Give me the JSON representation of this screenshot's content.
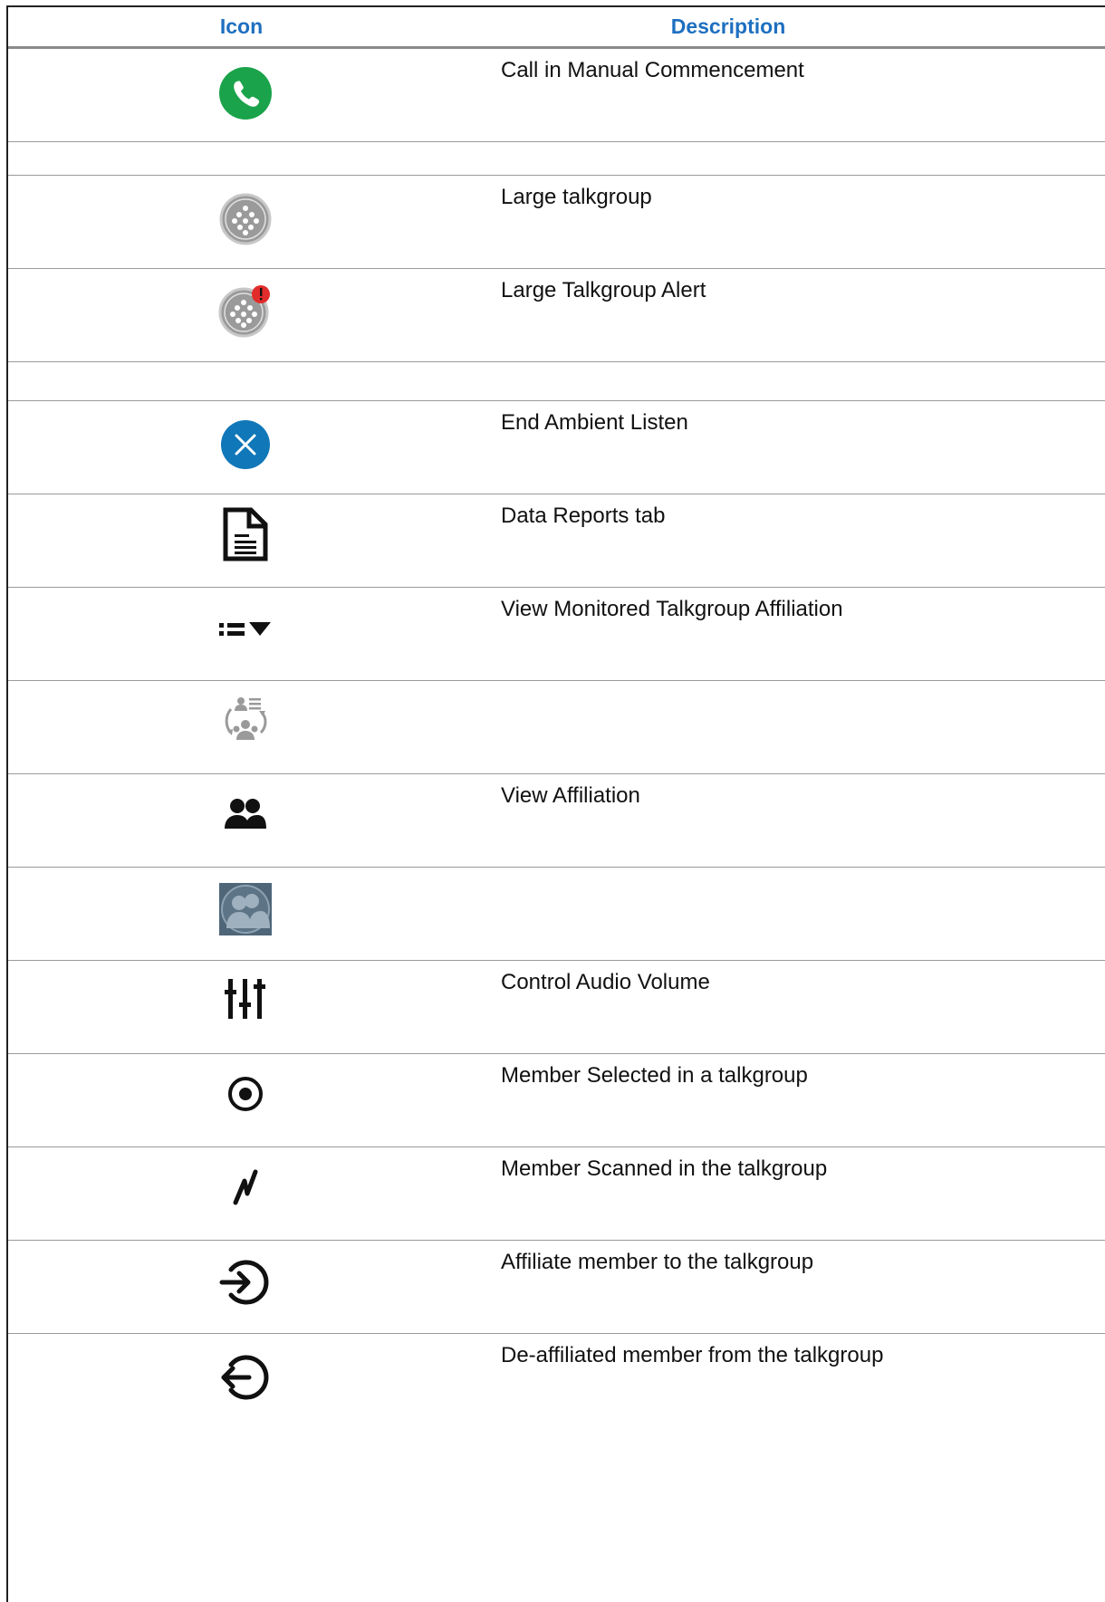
{
  "header": {
    "icon": "Icon",
    "description": "Description"
  },
  "colors": {
    "header_text": "#1e6fc0",
    "call_green": "#1aa34a",
    "ambient_blue": "#1077b8",
    "alert_red": "#e22b2b",
    "talkgroup_gray": "#9a9a9a"
  },
  "rows": [
    {
      "icon": "call-manual-commencement-icon",
      "label": "Call in Manual Commencement"
    },
    {
      "icon": "",
      "label": ""
    },
    {
      "icon": "large-talkgroup-icon",
      "label": "Large talkgroup"
    },
    {
      "icon": "large-talkgroup-alert-icon",
      "label": "Large Talkgroup Alert"
    },
    {
      "icon": "",
      "label": ""
    },
    {
      "icon": "end-ambient-listen-icon",
      "label": "End Ambient Listen"
    },
    {
      "icon": "data-reports-icon",
      "label": "Data Reports tab"
    },
    {
      "icon": "view-monitored-affiliation-icon",
      "label": "View Monitored Talkgroup Affiliation"
    },
    {
      "icon": "affiliation-cycle-icon",
      "label": ""
    },
    {
      "icon": "view-affiliation-icon",
      "label": "View Affiliation"
    },
    {
      "icon": "affiliation-photo-icon",
      "label": ""
    },
    {
      "icon": "audio-volume-icon",
      "label": "Control Audio Volume"
    },
    {
      "icon": "member-selected-icon",
      "label": "Member Selected in a talkgroup"
    },
    {
      "icon": "member-scanned-icon",
      "label": "Member Scanned in the talkgroup"
    },
    {
      "icon": "affiliate-member-icon",
      "label": "Affiliate member to the talkgroup"
    },
    {
      "icon": "deaffiliate-member-icon",
      "label": "De-affiliated member from the talkgroup"
    }
  ]
}
